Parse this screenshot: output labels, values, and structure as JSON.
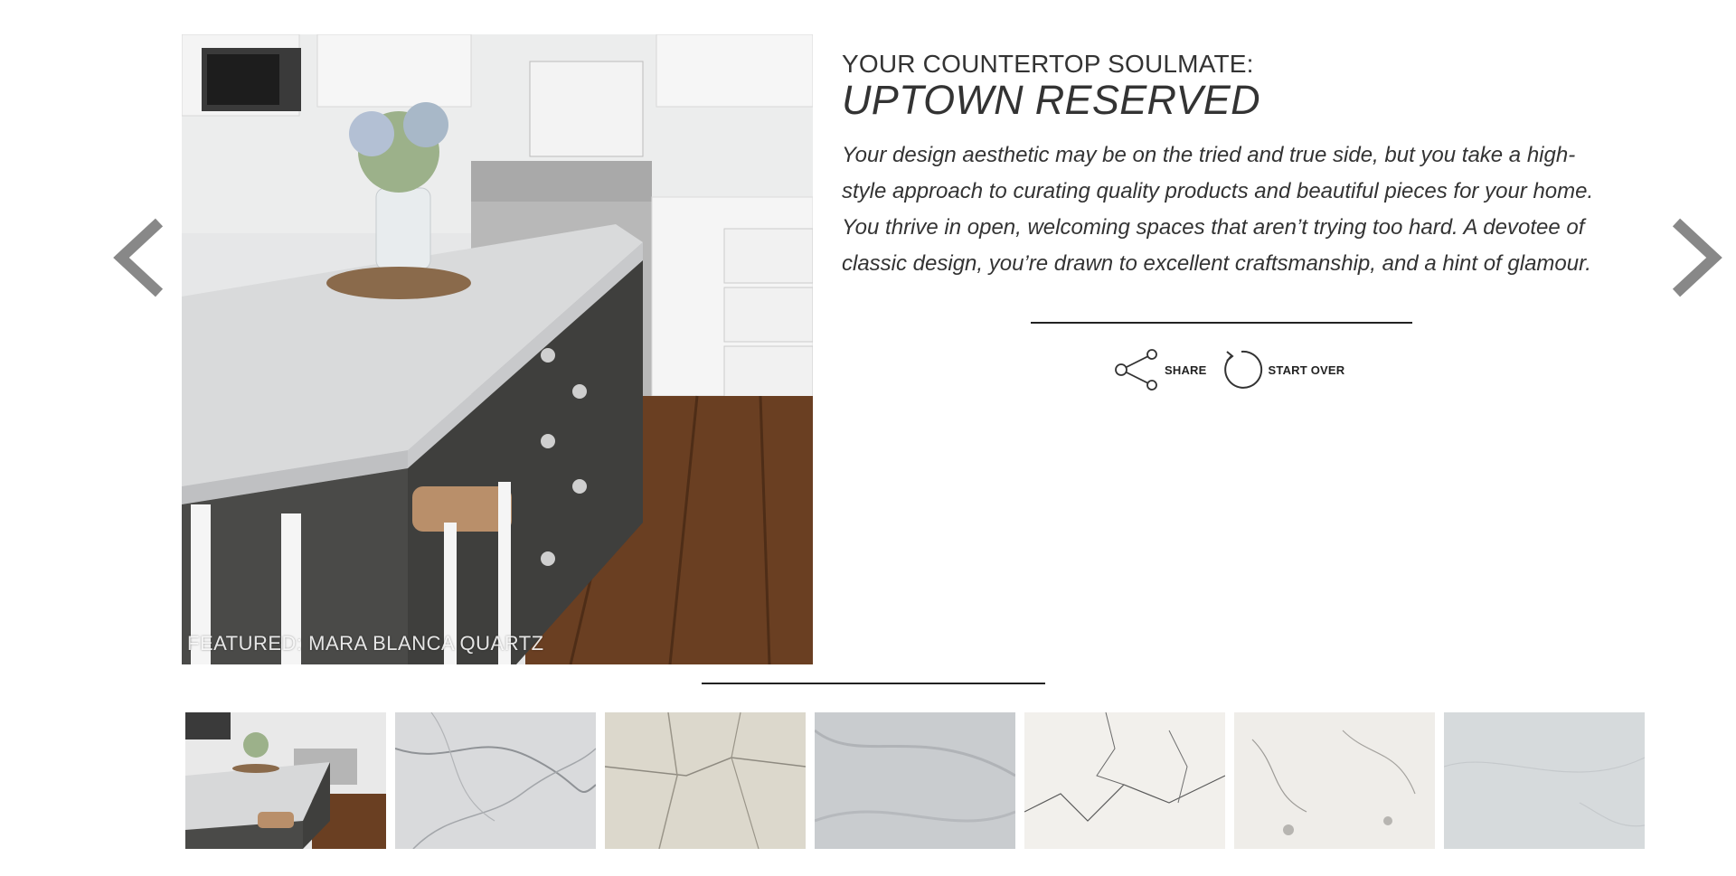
{
  "nav": {
    "prev_icon": "chevron-left-icon",
    "next_icon": "chevron-right-icon",
    "color": "#888888"
  },
  "hero": {
    "caption": "FEATURED: MARA BLANCA QUARTZ"
  },
  "result": {
    "kicker": "YOUR COUNTERTOP SOULMATE:",
    "name": "UPTOWN RESERVED",
    "description": "Your design aesthetic may be on the tried and true side, but you take a high-style approach to curating quality products and beautiful pieces for your home. You thrive in open, welcoming spaces that aren’t trying too hard. A devotee of classic design, you’re drawn to excellent craftsmanship, and a hint of glamour."
  },
  "actions": {
    "share": {
      "label": "SHARE",
      "icon": "share-icon"
    },
    "start_over": {
      "label": "START OVER",
      "icon": "restart-icon"
    }
  },
  "thumbnails": [
    {
      "kind": "kitchen-scene",
      "base": "#e9e9e9"
    },
    {
      "kind": "marble",
      "base": "#d9dadc"
    },
    {
      "kind": "marble",
      "base": "#dcd8cc"
    },
    {
      "kind": "marble",
      "base": "#c9cccf"
    },
    {
      "kind": "marble",
      "base": "#f2f0ec"
    },
    {
      "kind": "marble",
      "base": "#efede9"
    },
    {
      "kind": "marble",
      "base": "#d6dadc"
    }
  ]
}
